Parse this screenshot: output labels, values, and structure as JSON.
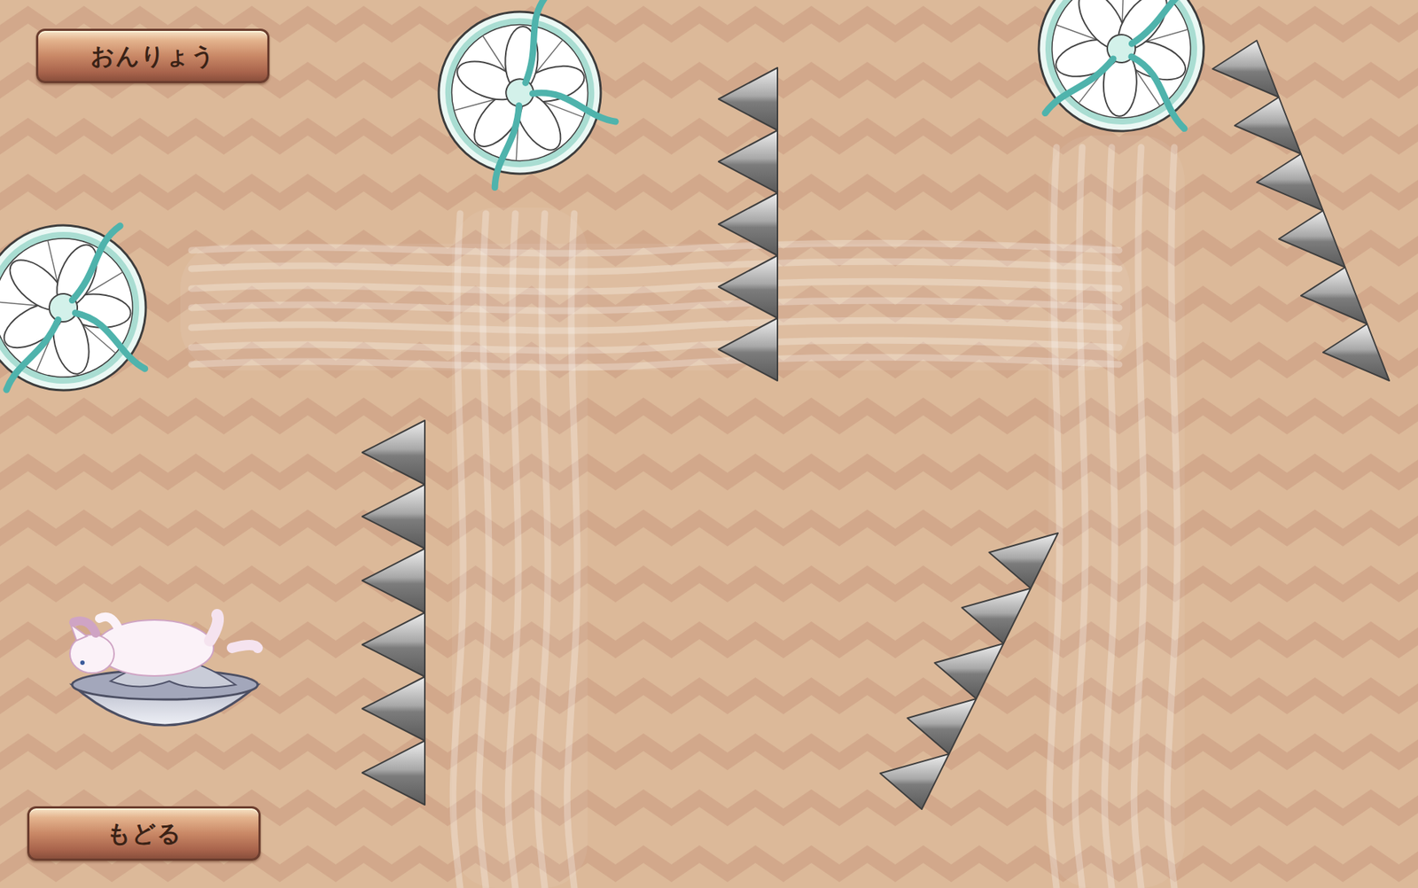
{
  "buttons": [
    {
      "label": "おんりょう",
      "position": "top"
    },
    {
      "label": "もどる",
      "position": "bottom"
    }
  ]
}
